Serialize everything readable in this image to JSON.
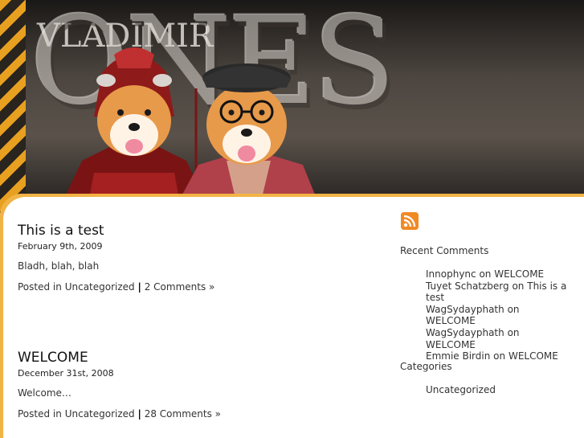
{
  "header": {
    "banner_text": "ONES",
    "banner_small_text": "VLADIMIR"
  },
  "posts": [
    {
      "title": "This is a test",
      "date": "February 9th, 2009",
      "body": "Bladh, blah, blah",
      "posted_in_label": "Posted in",
      "category": "Uncategorized",
      "separator": "|",
      "comments_link": "2 Comments »"
    },
    {
      "title": "WELCOME",
      "date": "December 31st, 2008",
      "body": "Welcome…",
      "posted_in_label": "Posted in",
      "category": "Uncategorized",
      "separator": "|",
      "comments_link": "28 Comments »"
    }
  ],
  "sidebar": {
    "rss_icon": "rss-feed-icon",
    "recent_comments_heading": "Recent Comments",
    "recent_comments": [
      {
        "author": "Innophync",
        "on": "on",
        "post": "WELCOME"
      },
      {
        "author": "Tuyet Schatzberg",
        "on": "on",
        "post": "This is a test"
      },
      {
        "author": "WagSydayphath",
        "on": "on",
        "post": "WELCOME"
      },
      {
        "author": "WagSydayphath",
        "on": "on",
        "post": "WELCOME"
      },
      {
        "author": "Emmie Birdin",
        "on": "on",
        "post": "WELCOME"
      }
    ],
    "categories_heading": "Categories",
    "categories": [
      "Uncategorized"
    ]
  },
  "colors": {
    "accent": "#f2b346",
    "rss": "#f08a24",
    "stripe": "#e8a020"
  }
}
